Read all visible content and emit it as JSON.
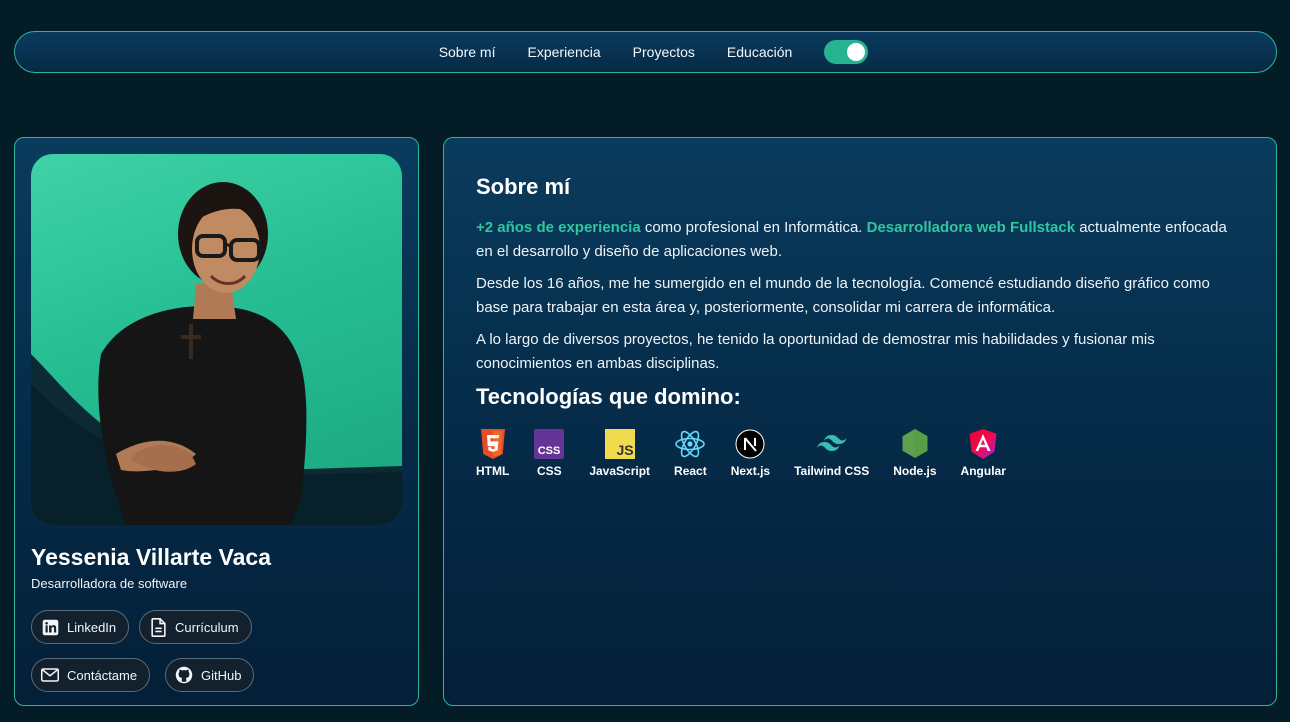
{
  "nav": {
    "items": [
      "Sobre mí",
      "Experiencia",
      "Proyectos",
      "Educación"
    ],
    "theme_toggle_on": true
  },
  "profile": {
    "name": "Yessenia Villarte Vaca",
    "role": "Desarrolladora de software",
    "buttons": {
      "linkedin": "LinkedIn",
      "curriculum": "Currículum",
      "contact": "Contáctame",
      "github": "GitHub"
    }
  },
  "about": {
    "title": "Sobre mí",
    "p1_highlight1": "+2 años de experiencia",
    "p1_text1": " como profesional en Informática. ",
    "p1_highlight2": "Desarrolladora web Fullstack",
    "p1_text2": " actualmente enfocada en el desarrollo y diseño de aplicaciones web.",
    "p2": "Desde los 16 años, me he sumergido en el mundo de la tecnología. Comencé estudiando diseño gráfico como base para trabajar en esta área y, posteriormente, consolidar mi carrera de informática.",
    "p3": "A lo largo de diversos proyectos, he tenido la oportunidad de demostrar mis habilidades y fusionar mis conocimientos en ambas disciplinas.",
    "tech_title": "Tecnologías que domino:",
    "techs": [
      {
        "label": "HTML",
        "icon": "html5-icon"
      },
      {
        "label": "CSS",
        "icon": "css-icon"
      },
      {
        "label": "JavaScript",
        "icon": "javascript-icon"
      },
      {
        "label": "React",
        "icon": "react-icon"
      },
      {
        "label": "Next.js",
        "icon": "nextjs-icon"
      },
      {
        "label": "Tailwind CSS",
        "icon": "tailwind-icon"
      },
      {
        "label": "Node.js",
        "icon": "nodejs-icon"
      },
      {
        "label": "Angular",
        "icon": "angular-icon"
      }
    ]
  },
  "colors": {
    "accent": "#2fc79c",
    "background": "#031c25",
    "card": "#0a3b5d"
  }
}
